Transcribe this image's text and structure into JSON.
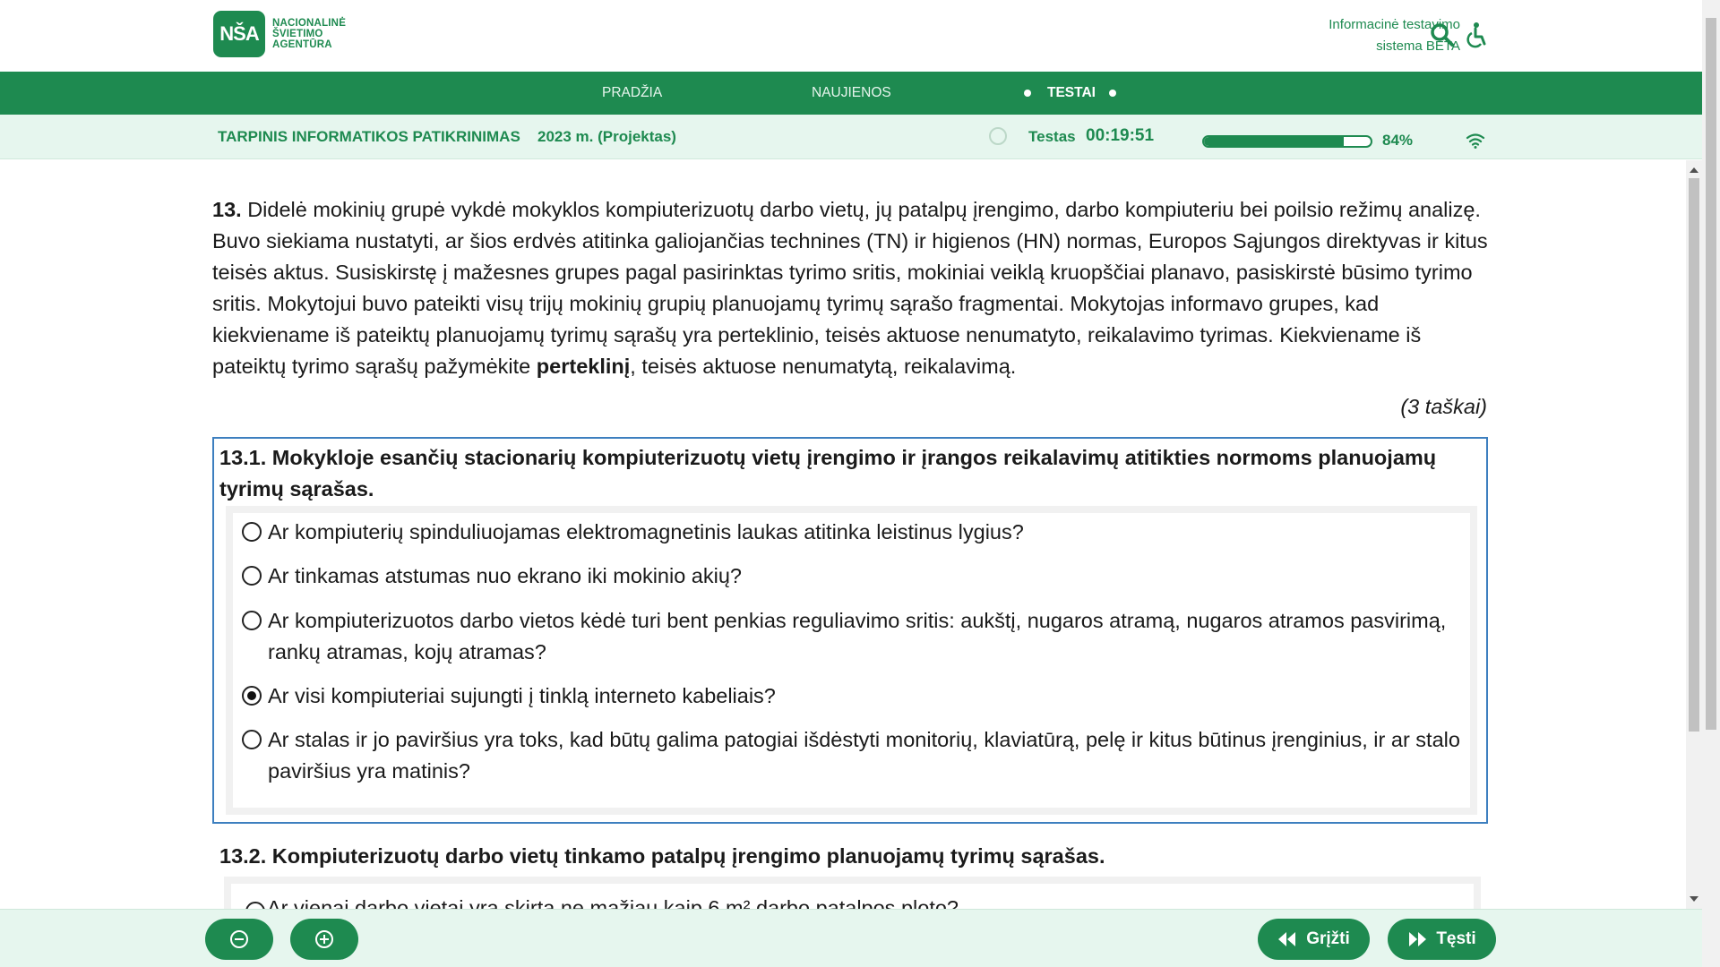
{
  "header": {
    "logo_mark": "NŠA",
    "logo_lines": [
      "NACIONALINĖ",
      "ŠVIETIMO",
      "AGENTŪRA"
    ],
    "system_line1": "Informacinė testavimo",
    "system_line2": "sistema BETA",
    "icons": [
      "search-icon",
      "accessibility-icon"
    ]
  },
  "nav": {
    "items": [
      {
        "label": "PRADŽIA"
      },
      {
        "label": "NAUJIENOS"
      },
      {
        "label": "TESTAI",
        "active": true
      }
    ],
    "color": "#1e8a50"
  },
  "testbar": {
    "title": "TARPINIS INFORMATIKOS PATIKRINIMAS",
    "year": "2023 m. (Projektas)",
    "timer_label": "Testas",
    "timer": "00:19:51",
    "progress_percent": 84,
    "progress_label": "84%"
  },
  "question": {
    "number": "13.",
    "intro": " Didelė mokinių grupė vykdė mokyklos kompiuterizuotų darbo vietų, jų patalpų įrengimo, darbo kompiuteriu bei poilsio režimų analizę. Buvo siekiama nustatyti, ar šios erdvės atitinka galiojančias technines (TN) ir higienos (HN) normas, Europos Sąjungos direktyvas ir kitus teisės aktus. Susiskirstę į mažesnes grupes pagal pasirinktas tyrimo sritis, mokiniai veiklą kruopščiai planavo, pasiskirstė būsimo tyrimo sritis. Mokytojui buvo pateikti visų trijų mokinių grupių planuojamų tyrimų sąrašo fragmentai. Mokytojas informavo grupes, kad kiekviename iš pateiktų planuojamų tyrimų sąrašų yra perteklinio, teisės aktuose nenumatyto, reikalavimo tyrimas. Kiekviename iš pateiktų tyrimo sąrašų pažymėkite ",
    "intro_bold": "perteklinį",
    "intro_end": ", teisės aktuose nenumatytą, reikalavimą.",
    "points": "(3 taškai)",
    "sub1": {
      "title": "13.1. Mokykloje esančių stacionarių kompiuterizuotų vietų įrengimo ir įrangos reikalavimų atitikties normoms planuojamų tyrimų sąrašas.",
      "options": [
        {
          "text": "Ar kompiuterių spinduliuojamas elektromagnetinis laukas atitinka leistinus lygius?",
          "checked": false
        },
        {
          "text": "Ar tinkamas atstumas nuo ekrano iki mokinio akių?",
          "checked": false
        },
        {
          "text": "Ar kompiuterizuotos darbo vietos kėdė turi bent penkias reguliavimo sritis: aukštį, nugaros atramą, nugaros atramos pasvirimą, rankų atramas, kojų atramas?",
          "checked": false
        },
        {
          "text": "Ar visi kompiuteriai sujungti į tinklą interneto kabeliais?",
          "checked": true
        },
        {
          "text": "Ar stalas ir jo paviršius yra toks, kad būtų galima patogiai išdėstyti monitorių, klaviatūrą, pelę ir kitus būtinus įrenginius, ir ar stalo paviršius yra matinis?",
          "checked": false
        }
      ]
    },
    "sub2": {
      "title": "13.2. Kompiuterizuotų darbo vietų tinkamo patalpų įrengimo planuojamų tyrimų sąrašas.",
      "partial_option": "Ar vienai darbo vietai yra skirta ne mažiau kaip 6 m² darbo patalpos ploto?"
    }
  },
  "footer": {
    "back_label": "Grįžti",
    "next_label": "Tęsti",
    "icons": [
      "zoom-out-icon",
      "zoom-in-icon",
      "rewind-icon",
      "fast-forward-icon"
    ]
  }
}
